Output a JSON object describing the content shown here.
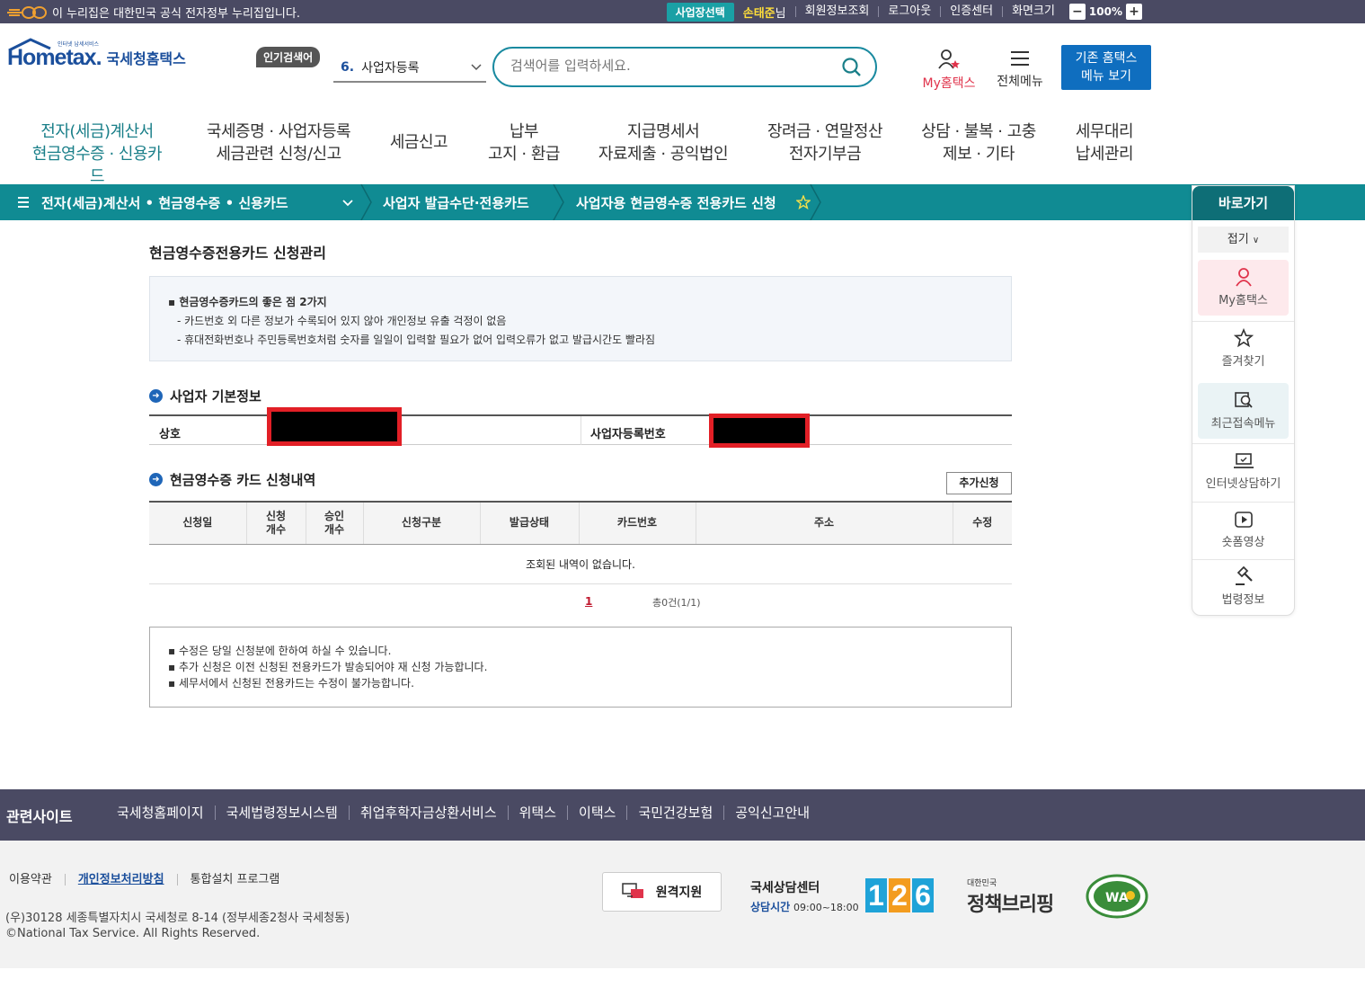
{
  "govbar": {
    "notice": "이 누리집은 대한민국 공식 전자정부 누리집입니다.",
    "biz_select": "사업장선택",
    "user_name": "손태준",
    "user_suffix": "님",
    "links": [
      "회원정보조회",
      "로그아웃",
      "인증센터",
      "화면크기"
    ],
    "zoom": "100%",
    "zoom_minus": "−",
    "zoom_plus": "+"
  },
  "header": {
    "logo_text": "Hometax.",
    "logo_tiny": "인터넷 납세서비스",
    "logo_kor": "국세청홈택스",
    "popular_tag": "인기검색어",
    "popular_num": "6.",
    "popular_value": "사업자등록",
    "search_placeholder": "검색어를 입력하세요.",
    "my_label": "My홈택스",
    "allmenu_label": "전체메뉴",
    "old_menu_line1": "기존 홈택스",
    "old_menu_line2": "메뉴 보기"
  },
  "gnb": [
    {
      "l1": "전자(세금)계산서",
      "l2": "현금영수증 · 신용카드",
      "active": true
    },
    {
      "l1": "국세증명 · 사업자등록",
      "l2": "세금관련 신청/신고"
    },
    {
      "l1": "세금신고",
      "l2": ""
    },
    {
      "l1": "납부",
      "l2": "고지 · 환급"
    },
    {
      "l1": "지급명세서",
      "l2": "자료제출 · 공익법인"
    },
    {
      "l1": "장려금 · 연말정산",
      "l2": "전자기부금"
    },
    {
      "l1": "상담 · 불복 · 고충",
      "l2": "제보 · 기타"
    },
    {
      "l1": "세무대리",
      "l2": "납세관리"
    }
  ],
  "breadcrumb": {
    "level1": "전자(세금)계산서 • 현금영수증 • 신용카드",
    "level2": "사업자 발급수단·전용카드",
    "level3": "사업자용 현금영수증 전용카드 신청"
  },
  "quick": {
    "title": "바로가기",
    "fold": "접기",
    "items": [
      "My홈택스",
      "즐겨찾기",
      "최근접속메뉴",
      "인터넷상담하기",
      "숏폼영상",
      "법령정보"
    ]
  },
  "main": {
    "page_title": "현금영수증전용카드 신청관리",
    "info_head": "현금영수증카드의 좋은 점 2가지",
    "info_1": "- 카드번호 외 다른 정보가 수록되어 있지 않아 개인정보 유출 걱정이 없음",
    "info_2": "- 휴대전화번호나 주민등록번호처럼 숫자를 일일이 입력할 필요가 없어 입력오류가 없고 발급시간도 빨라짐",
    "section1": "사업자 기본정보",
    "label_trade": "상호",
    "label_bizno": "사업자등록번호",
    "section2": "현금영수증 카드 신청내역",
    "add_button": "추가신청",
    "columns": [
      {
        "line1": "신청일",
        "line2": ""
      },
      {
        "line1": "신청",
        "line2": "개수"
      },
      {
        "line1": "승인",
        "line2": "개수"
      },
      {
        "line1": "신청구분",
        "line2": ""
      },
      {
        "line1": "발급상태",
        "line2": ""
      },
      {
        "line1": "카드번호",
        "line2": ""
      },
      {
        "line1": "주소",
        "line2": ""
      },
      {
        "line1": "수정",
        "line2": ""
      }
    ],
    "empty_message": "조회된 내역이 없습니다.",
    "page": "1",
    "total": "총0건(1/1)",
    "notes": [
      "수정은 당일 신청분에 한하여 하실 수 있습니다.",
      "추가 신청은 이전 신청된 전용카드가 발송되어야 재 신청 가능합니다.",
      "세무서에서 신청된 전용카드는 수정이 불가능합니다."
    ]
  },
  "related": {
    "title": "관련사이트",
    "links": [
      "국세청홈페이지",
      "국세법령정보시스템",
      "취업후학자금상환서비스",
      "위택스",
      "이택스",
      "국민건강보험",
      "공익신고안내"
    ]
  },
  "footer": {
    "links": [
      "이용약관",
      "개인정보처리방침",
      "통합설치 프로그램"
    ],
    "address": "(우)30128 세종특별자치시 국세청로 8-14 (정부세종2청사 국세청동)",
    "copyright": "©National Tax Service. All Rights Reserved.",
    "remote": "원격지원",
    "center_title": "국세상담센터",
    "center_hours_label": "상담시간",
    "center_hours": "09:00~18:00",
    "digits": [
      "1",
      "2",
      "6"
    ],
    "policy_small": "대한민국",
    "policy_main": "정책브리핑"
  },
  "colors": {
    "teal": "#108b93",
    "navy_bar": "#4a4a63",
    "brand_blue": "#1b4f9c",
    "redact_border": "#e21f26"
  }
}
